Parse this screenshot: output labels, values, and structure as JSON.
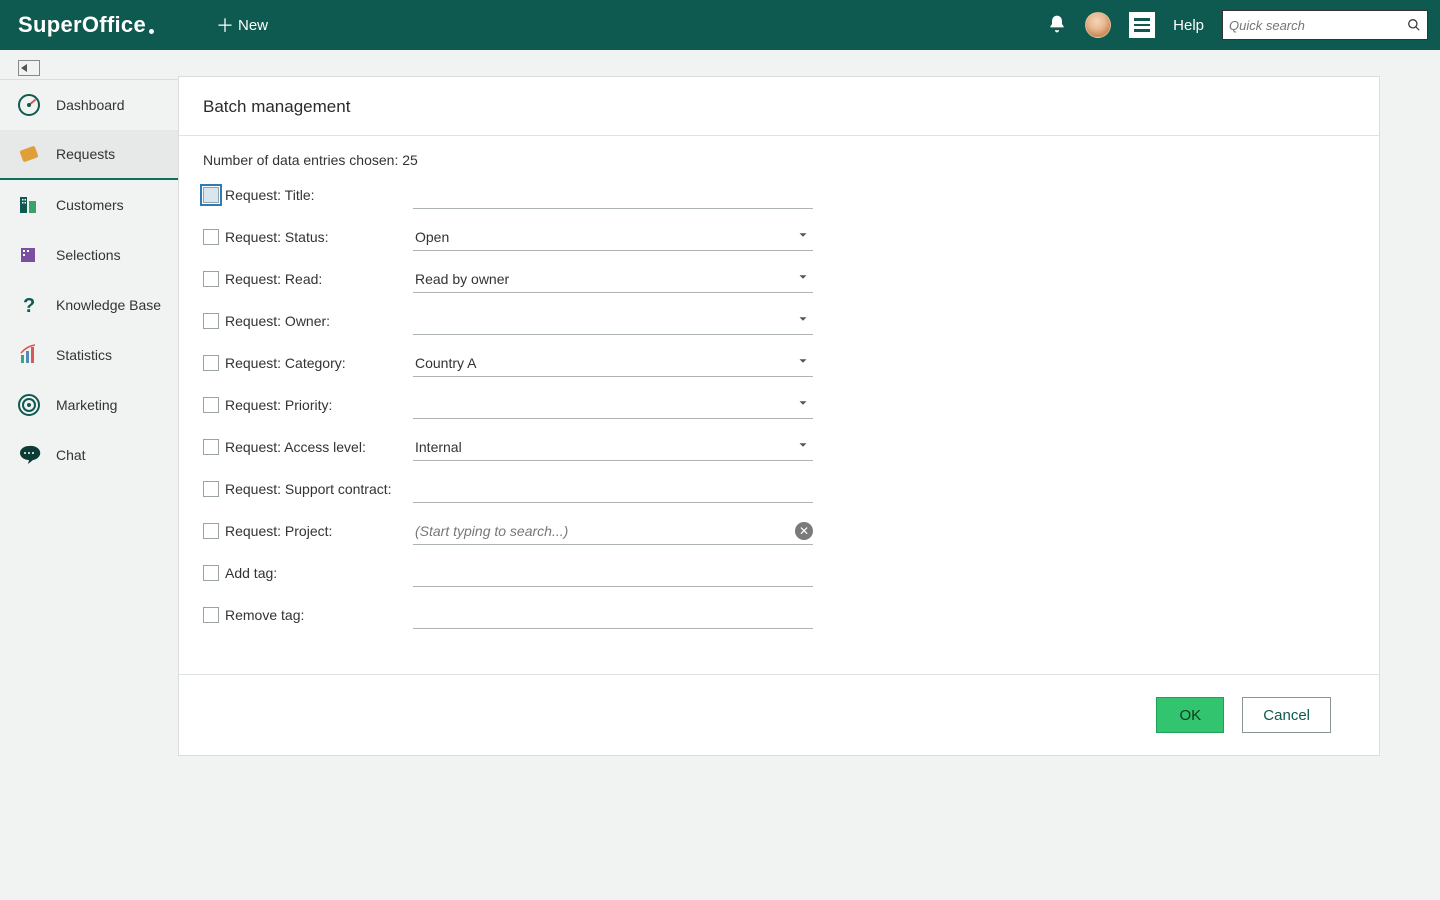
{
  "header": {
    "logo": "SuperOffice",
    "new_label": "New",
    "help_label": "Help",
    "search_placeholder": "Quick search"
  },
  "sidebar": {
    "items": [
      {
        "id": "dashboard",
        "label": "Dashboard"
      },
      {
        "id": "requests",
        "label": "Requests"
      },
      {
        "id": "customers",
        "label": "Customers"
      },
      {
        "id": "selections",
        "label": "Selections"
      },
      {
        "id": "knowledge-base",
        "label": "Knowledge Base"
      },
      {
        "id": "statistics",
        "label": "Statistics"
      },
      {
        "id": "marketing",
        "label": "Marketing"
      },
      {
        "id": "chat",
        "label": "Chat"
      }
    ],
    "active": "requests"
  },
  "panel": {
    "title": "Batch management",
    "entries_label": "Number of data entries chosen: 25",
    "fields": {
      "title_label": "Request: Title:",
      "status_label": "Request: Status:",
      "status_value": "Open",
      "read_label": "Request: Read:",
      "read_value": "Read by owner",
      "owner_label": "Request: Owner:",
      "owner_value": "",
      "category_label": "Request: Category:",
      "category_value": "Country A",
      "priority_label": "Request: Priority:",
      "priority_value": "",
      "access_label": "Request: Access level:",
      "access_value": "Internal",
      "support_label": "Request: Support contract:",
      "project_label": "Request: Project:",
      "project_placeholder": "(Start typing to search...)",
      "addtag_label": "Add tag:",
      "removetag_label": "Remove tag:"
    },
    "ok_label": "OK",
    "cancel_label": "Cancel"
  }
}
